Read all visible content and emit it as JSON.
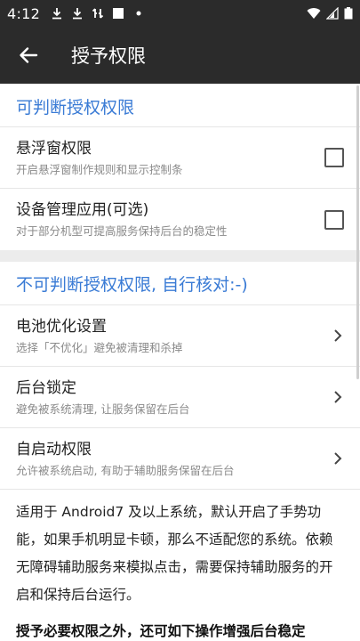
{
  "status": {
    "time": "4:12"
  },
  "appbar": {
    "title": "授予权限"
  },
  "section1": {
    "header": "可判断授权权限",
    "items": [
      {
        "label": "悬浮窗权限",
        "desc": "开启悬浮窗制作规则和显示控制条",
        "control": "checkbox",
        "checked": false
      },
      {
        "label": "设备管理应用(可选)",
        "desc": "对于部分机型可提高服务保持后台的稳定性",
        "control": "checkbox",
        "checked": false
      }
    ]
  },
  "section2": {
    "header": "不可判断授权权限, 自行核对:-)",
    "items": [
      {
        "label": "电池优化设置",
        "desc": "选择「不优化」避免被清理和杀掉",
        "control": "chevron"
      },
      {
        "label": "后台锁定",
        "desc": "避免被系统清理, 让服务保留在后台",
        "control": "chevron"
      },
      {
        "label": "自启动权限",
        "desc": "允许被系统启动, 有助于辅助服务保留在后台",
        "control": "chevron"
      }
    ]
  },
  "info": {
    "paragraph": "适用于 Android7 及以上系统，默认开启了手势功能，如果手机明显卡顿，那么不适配您的系统。依赖无障碍辅助服务来模拟点击，需要保持辅助服务的开启和保持后台运行。",
    "bold": "授予必要权限之外，还可如下操作增强后台稳定"
  },
  "colors": {
    "accent": "#3a7bd5",
    "bar": "#2b2b2b"
  }
}
